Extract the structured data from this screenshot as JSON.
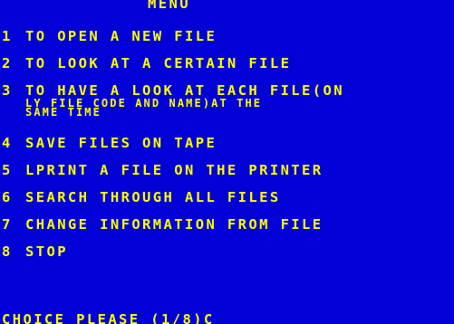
{
  "screen": {
    "title": "MENU",
    "items": [
      {
        "num": "1",
        "label": "TO OPEN A NEW FILE"
      },
      {
        "num": "2",
        "label": "TO LOOK AT A CERTAIN FILE"
      },
      {
        "num": "3",
        "label_line1": "TO HAVE A LOOK AT EACH FILE(ON",
        "label_line2": "LY FILE CODE AND NAME)AT THE",
        "label_line3": "SAME TIME"
      },
      {
        "num": "4",
        "label": "SAVE FILES ON TAPE"
      },
      {
        "num": "5",
        "label": "LPRINT A FILE ON THE PRINTER"
      },
      {
        "num": "6",
        "label": "SEARCH THROUGH ALL FILES"
      },
      {
        "num": "7",
        "label": "CHANGE INFORMATION FROM FILE"
      },
      {
        "num": "8",
        "label": "STOP"
      }
    ],
    "prompt": "CHOICE PLEASE (1/8)",
    "cursor": "C"
  },
  "colors": {
    "background": "#0000d7",
    "text": "#ffff00"
  }
}
